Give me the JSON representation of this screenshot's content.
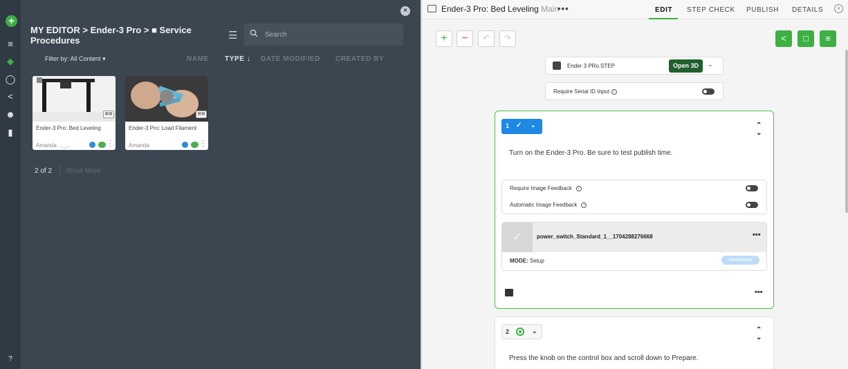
{
  "rail": {
    "icons": [
      "plus-circle-icon",
      "checklist-icon",
      "layers-icon",
      "person-icon",
      "share-icon",
      "group-icon",
      "trash-icon",
      "help-icon"
    ]
  },
  "library": {
    "breadcrumb": "MY EDITOR > Ender-3 Pro > ■ Service Procedures",
    "search_placeholder": "Search",
    "filter_label": "Filter by: All Content",
    "columns": [
      "NAME",
      "TYPE ↓",
      "DATE MODIFIED",
      "CREATED BY"
    ],
    "cards": [
      {
        "title": "Ender-3 Pro: Bed Leveling",
        "author": "Amanda ..._..."
      },
      {
        "title": "Ender-3 Pro: Load Filament",
        "author": "Amanda"
      }
    ],
    "count": "2 of 2",
    "show_more": "Show More"
  },
  "editor": {
    "doc_title": "Ender-3 Pro: Bed Leveling",
    "branch": "Main",
    "tabs": [
      "EDIT",
      "STEP CHECK",
      "PUBLISH",
      "DETAILS"
    ],
    "file_name": "Ender 3 PRo.STEP",
    "open3d_label": "Open 3D",
    "serial_label": "Require Serial ID Input",
    "step1": {
      "number": "1",
      "description": "Turn on the Ender-3 Pro. Be sure to test publish time.",
      "require_image_feedback": "Require Image Feedback",
      "automatic_image_feedback": "Automatic Image Feedback",
      "media_name": "power_switch_Standard_1__1704288276668",
      "mode_label": "MODE:",
      "mode_value": "Setup",
      "dashboard_label": "Dashboard"
    },
    "step2": {
      "number": "2",
      "description": "Press the knob on the control box and scroll down to Prepare."
    }
  },
  "colors": {
    "accent_green": "#3cb043",
    "accent_blue": "#1e88e5",
    "panel_dark": "#3b4651"
  }
}
